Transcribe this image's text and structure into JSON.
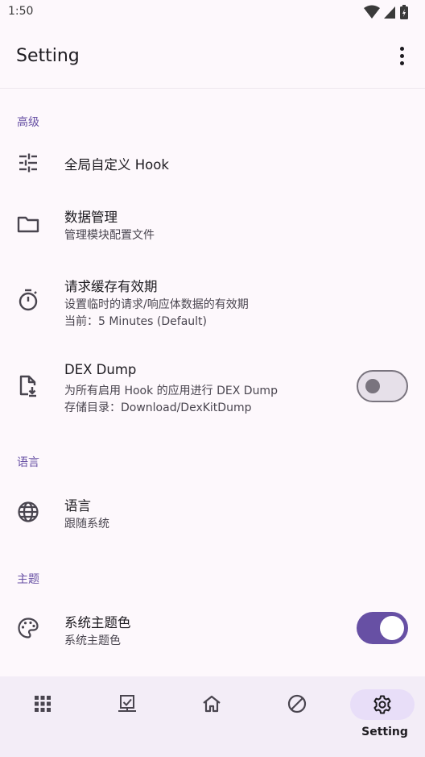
{
  "status_bar": {
    "time": "1:50"
  },
  "app_bar": {
    "title": "Setting"
  },
  "sections": {
    "advanced": "高级",
    "language": "语言",
    "theme": "主题"
  },
  "items": {
    "global_hook": {
      "title": "全局自定义 Hook"
    },
    "data_mgmt": {
      "title": "数据管理",
      "subtitle": "管理模块配置文件"
    },
    "cache": {
      "title": "请求缓存有效期",
      "subtitle": "设置临时的请求/响应体数据的有效期",
      "subtitle2": "当前：5 Minutes (Default)"
    },
    "dex_dump": {
      "title": "DEX Dump",
      "subtitle": "为所有启用 Hook 的应用进行 DEX Dump",
      "subtitle2": "存储目录：Download/DexKitDump",
      "enabled": false
    },
    "language": {
      "title": "语言",
      "subtitle": "跟随系统"
    },
    "theme_color": {
      "title": "系统主题色",
      "subtitle": "系统主题色",
      "enabled": true
    }
  },
  "bottom_nav": {
    "items": [
      {
        "icon": "apps-icon",
        "label": ""
      },
      {
        "icon": "checklist-monitor-icon",
        "label": ""
      },
      {
        "icon": "home-icon",
        "label": ""
      },
      {
        "icon": "block-icon",
        "label": ""
      },
      {
        "icon": "gear-icon",
        "label": "Setting",
        "active": true
      }
    ]
  },
  "colors": {
    "accent": "#6750a4",
    "background": "#fdf8fc",
    "nav_background": "#f3edf7",
    "nav_indicator": "#e8def8"
  }
}
